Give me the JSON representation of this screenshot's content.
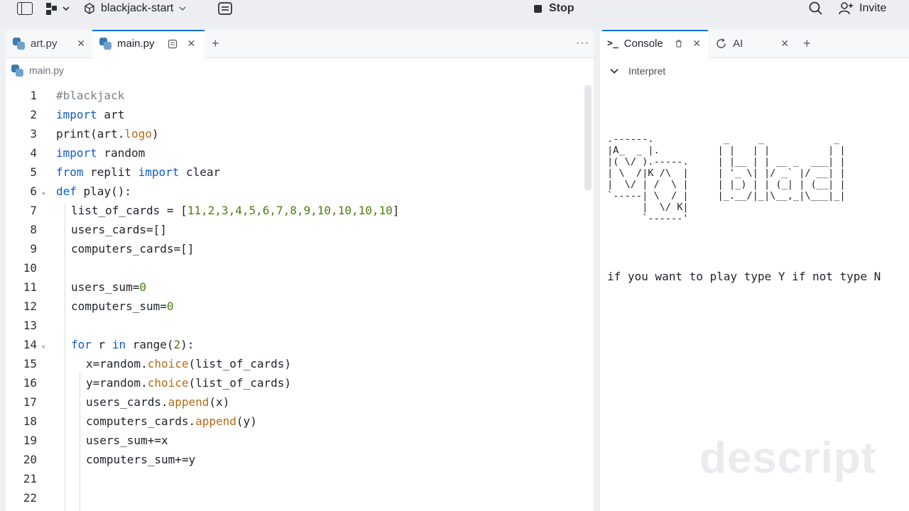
{
  "topbar": {
    "project_name": "blackjack-start",
    "stop_label": "Stop",
    "invite_label": "Invite"
  },
  "editor": {
    "tabs": [
      {
        "label": "art.py"
      },
      {
        "label": "main.py"
      }
    ],
    "breadcrumb": "main.py",
    "lines": [
      {
        "n": "1"
      },
      {
        "n": "2"
      },
      {
        "n": "3"
      },
      {
        "n": "4"
      },
      {
        "n": "5"
      },
      {
        "n": "6"
      },
      {
        "n": "7"
      },
      {
        "n": "8"
      },
      {
        "n": "9"
      },
      {
        "n": "10"
      },
      {
        "n": "11"
      },
      {
        "n": "12"
      },
      {
        "n": "13"
      },
      {
        "n": "14"
      },
      {
        "n": "15"
      },
      {
        "n": "16"
      },
      {
        "n": "17"
      },
      {
        "n": "18"
      },
      {
        "n": "19"
      },
      {
        "n": "20"
      },
      {
        "n": "21"
      },
      {
        "n": "22"
      }
    ],
    "code": {
      "l1": "#blackjack",
      "l2_kw": "import",
      "l2_rest": " art",
      "l3_a": "print(art.",
      "l3_fn": "logo",
      "l3_b": ")",
      "l4_kw": "import",
      "l4_rest": " random",
      "l5_kw1": "from",
      "l5_mid": " replit ",
      "l5_kw2": "import",
      "l5_rest": " clear",
      "l6_kw": "def",
      "l6_rest": " play():",
      "l7_a": "list_of_cards = [",
      "l7_nums": "11,2,3,4,5,6,7,8,9,10,10,10,10",
      "l7_b": "]",
      "l8": "users_cards=[]",
      "l9": "computers_cards=[]",
      "l11_a": "users_sum=",
      "l11_n": "0",
      "l12_a": "computers_sum=",
      "l12_n": "0",
      "l14_kw1": "for",
      "l14_a": " r ",
      "l14_kw2": "in",
      "l14_b": " range(",
      "l14_n": "2",
      "l14_c": "):",
      "l15_a": "x=random.",
      "l15_fn": "choice",
      "l15_b": "(list_of_cards)",
      "l16_a": "y=random.",
      "l16_fn": "choice",
      "l16_b": "(list_of_cards)",
      "l17_a": "users_cards.",
      "l17_fn": "append",
      "l17_b": "(x)",
      "l18_a": "computers_cards.",
      "l18_fn": "append",
      "l18_b": "(y)",
      "l19": "users_sum+=x",
      "l20": "computers_sum+=y"
    }
  },
  "console": {
    "tabs": [
      {
        "label": "Console"
      },
      {
        "label": "AI"
      }
    ],
    "interpret_label": "Interpret",
    "ascii_art": ".------.            _     _            _\n|A_  _ |.          | |   | |          | |\n|( \\/ ).-----.     | |__ | | __ _  ___| |\n| \\  /|K /\\  |     | '_ \\| |/ _` |/ __| |\n|  \\/ | /  \\ |     | |_) | | (_| | (__| |\n`-----| \\  / |     |_.__/|_|\\__,_|\\___|_|\n      |  \\/ K|\n      `------'",
    "prompt": "if you want to play type Y if not type N"
  },
  "watermark": "descript"
}
